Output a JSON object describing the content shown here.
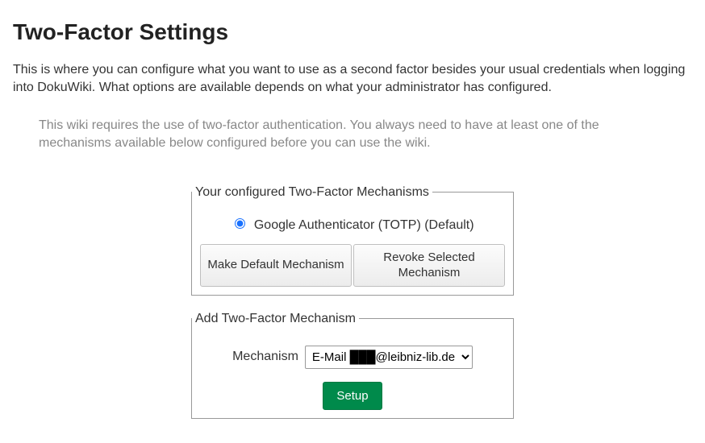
{
  "page_title": "Two-Factor Settings",
  "intro_text": "This is where you can configure what you want to use as a second factor besides your usual credentials when logging into DokuWiki. What options are available depends on what your administrator has configured.",
  "notice_text": "This wiki requires the use of two-factor authentication. You always need to have at least one of the mechanisms available below configured before you can use the wiki.",
  "configured": {
    "legend": "Your configured Two-Factor Mechanisms",
    "items": [
      {
        "label": "Google Authenticator (TOTP) (Default)",
        "selected": true
      }
    ],
    "make_default_label": "Make Default Mechanism",
    "revoke_label": "Revoke Selected Mechanism"
  },
  "add": {
    "legend": "Add Two-Factor Mechanism",
    "label": "Mechanism",
    "option_prefix": "E-Mail ",
    "option_domain": "@leibniz-lib.de",
    "setup_label": "Setup"
  }
}
